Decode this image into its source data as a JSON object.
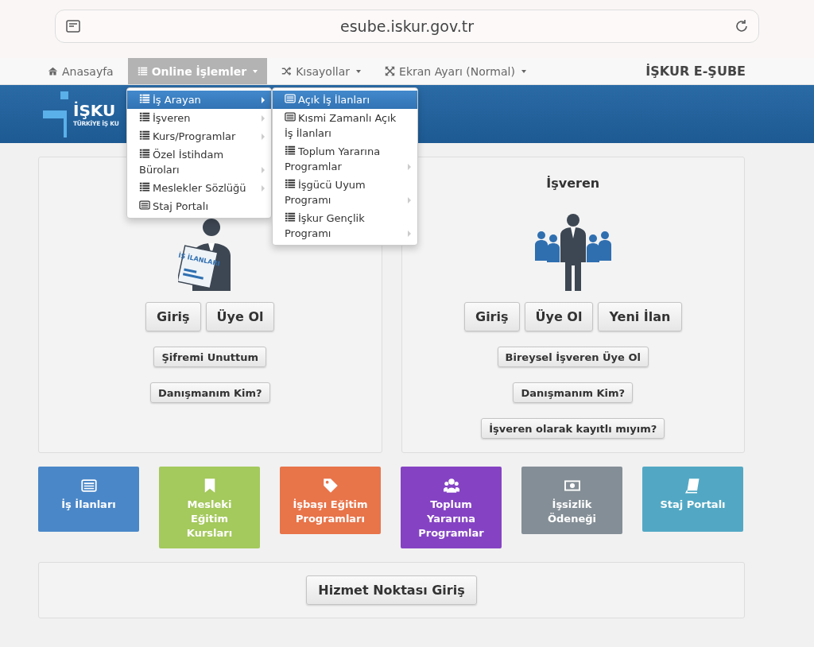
{
  "address_bar": {
    "url": "esube.iskur.gov.tr"
  },
  "nav": {
    "items": [
      {
        "label": "Anasayfa",
        "kind": "home",
        "selected": false,
        "dropdown": false
      },
      {
        "label": "Online İşlemler",
        "kind": "list",
        "selected": true,
        "dropdown": true
      },
      {
        "label": "Kısayollar",
        "kind": "shuffle",
        "selected": false,
        "dropdown": true
      },
      {
        "label": "Ekran Ayarı (Normal)",
        "kind": "expand",
        "selected": false,
        "dropdown": true
      }
    ],
    "brand": "İŞKUR E-ŞUBE"
  },
  "banner": {
    "logo_text": "İŞKU",
    "logo_subtitle": "TÜRKİYE İŞ KU"
  },
  "menu": {
    "items": [
      {
        "label": "İş Arayan",
        "kind": "list",
        "selected": true,
        "submenu": true
      },
      {
        "label": "İşveren",
        "kind": "list",
        "selected": false,
        "submenu": true
      },
      {
        "label": "Kurs/Programlar",
        "kind": "list",
        "selected": false,
        "submenu": true
      },
      {
        "label": "Özel İstihdam Büroları",
        "kind": "list",
        "selected": false,
        "submenu": true
      },
      {
        "label": "Meslekler Sözlüğü",
        "kind": "list",
        "selected": false,
        "submenu": true
      },
      {
        "label": "Staj Portalı",
        "kind": "card",
        "selected": false,
        "submenu": false
      }
    ]
  },
  "submenu": {
    "items": [
      {
        "label": "Açık İş İlanları",
        "kind": "card",
        "selected": true,
        "submenu": false
      },
      {
        "label": "Kısmi Zamanlı Açık İş İlanları",
        "kind": "card",
        "selected": false,
        "submenu": false
      },
      {
        "label": "Toplum Yararına Programlar",
        "kind": "list",
        "selected": false,
        "submenu": true
      },
      {
        "label": "İşgücü Uyum Programı",
        "kind": "list",
        "selected": false,
        "submenu": true
      },
      {
        "label": "İşkur Gençlik Programı",
        "kind": "list",
        "selected": false,
        "submenu": true
      }
    ]
  },
  "panels": [
    {
      "kind": "job_seeker",
      "figure_text": "İŞ İLANLARI",
      "big_buttons": [
        "Giriş",
        "Üye Ol"
      ],
      "small_buttons": [
        "Şifremi Unuttum",
        "Danışmanım Kim?"
      ]
    },
    {
      "title": "İşveren",
      "kind": "employer",
      "big_buttons": [
        "Giriş",
        "Üye Ol",
        "Yeni İlan"
      ],
      "small_buttons": [
        "Bireysel İşveren Üye Ol",
        "Danışmanım Kim?",
        "İşveren olarak kayıtlı mıyım?"
      ]
    }
  ],
  "tiles": [
    {
      "label": "İş İlanları",
      "kind": "card",
      "color": "#4a87c8"
    },
    {
      "label": "Mesleki Eğitim Kursları",
      "kind": "bookmark",
      "color": "#a4c95c"
    },
    {
      "label": "İşbaşı Eğitim Programları",
      "kind": "tag",
      "color": "#e8744a"
    },
    {
      "label": "Toplum Yararına Programlar",
      "kind": "users",
      "color": "#8543c4"
    },
    {
      "label": "İşsizlik Ödeneği",
      "kind": "money",
      "color": "#848e96"
    },
    {
      "label": "Staj Portalı",
      "kind": "book",
      "color": "#52a8c4"
    }
  ],
  "bottom": {
    "button": "Hizmet Noktası Giriş"
  }
}
